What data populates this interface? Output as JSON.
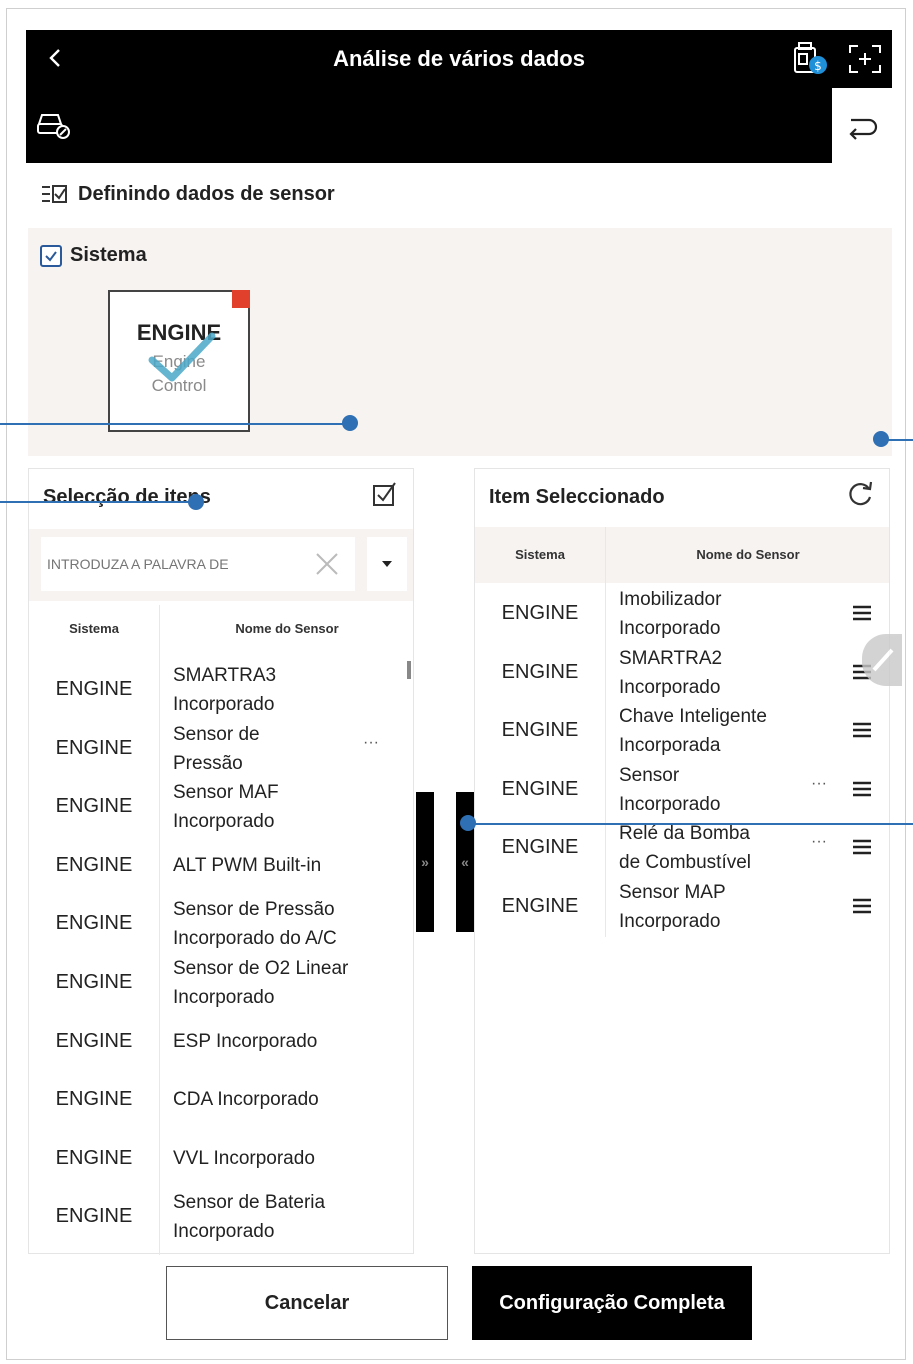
{
  "header": {
    "title": "Análise de vários dados"
  },
  "section": {
    "title": "Definindo dados de sensor"
  },
  "system": {
    "label": "Sistema",
    "card_name": "ENGINE",
    "card_sub1": "Engine",
    "card_sub2": "Control"
  },
  "left": {
    "title": "Selecção de itens",
    "search_placeholder": "INTRODUZA A PALAVRA DE",
    "col_system": "Sistema",
    "col_name": "Nome do Sensor",
    "rows": [
      {
        "sys": "ENGINE",
        "l1": "SMARTRA3",
        "l2": "Incorporado"
      },
      {
        "sys": "ENGINE",
        "l1": "Sensor de",
        "l2": "Pressão"
      },
      {
        "sys": "ENGINE",
        "l1": "Sensor MAF",
        "l2": "Incorporado"
      },
      {
        "sys": "ENGINE",
        "l1": "ALT PWM Built-in",
        "l2": ""
      },
      {
        "sys": "ENGINE",
        "l1": "Sensor de Pressão",
        "l2": "Incorporado do A/C"
      },
      {
        "sys": "ENGINE",
        "l1": "Sensor de O2 Linear",
        "l2": "Incorporado"
      },
      {
        "sys": "ENGINE",
        "l1": "ESP Incorporado",
        "l2": ""
      },
      {
        "sys": "ENGINE",
        "l1": "CDA Incorporado",
        "l2": ""
      },
      {
        "sys": "ENGINE",
        "l1": "VVL Incorporado",
        "l2": ""
      },
      {
        "sys": "ENGINE",
        "l1": "Sensor de Bateria",
        "l2": "Incorporado"
      }
    ]
  },
  "right": {
    "title": "Item Seleccionado",
    "col_system": "Sistema",
    "col_name": "Nome do Sensor",
    "rows": [
      {
        "sys": "ENGINE",
        "l1": "Imobilizador",
        "l2": "Incorporado"
      },
      {
        "sys": "ENGINE",
        "l1": "SMARTRA2",
        "l2": "Incorporado"
      },
      {
        "sys": "ENGINE",
        "l1": "Chave Inteligente",
        "l2": "Incorporada"
      },
      {
        "sys": "ENGINE",
        "l1": "Sensor",
        "l2": "Incorporado"
      },
      {
        "sys": "ENGINE",
        "l1": "Relé da Bomba",
        "l2": "de Combustível"
      },
      {
        "sys": "ENGINE",
        "l1": "Sensor MAP",
        "l2": "Incorporado"
      }
    ]
  },
  "transfer": {
    "add": "»",
    "remove": "«"
  },
  "buttons": {
    "cancel": "Cancelar",
    "complete": "Configuração Completa"
  },
  "ellipsis": "···",
  "colors": {
    "accent": "#2f6fb3",
    "header_bg": "#000000",
    "panel_bg": "#f6f3f1",
    "marker": "#e0402c",
    "check": "#4aa8c8"
  }
}
